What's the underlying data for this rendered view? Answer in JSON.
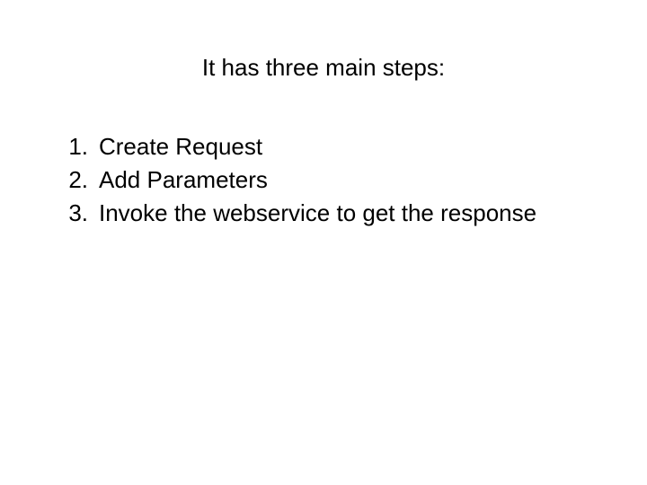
{
  "title": "It has three main steps:",
  "steps": [
    {
      "label": "Create Request"
    },
    {
      "label": "Add Parameters"
    },
    {
      "label": "Invoke the webservice to get the response"
    }
  ]
}
